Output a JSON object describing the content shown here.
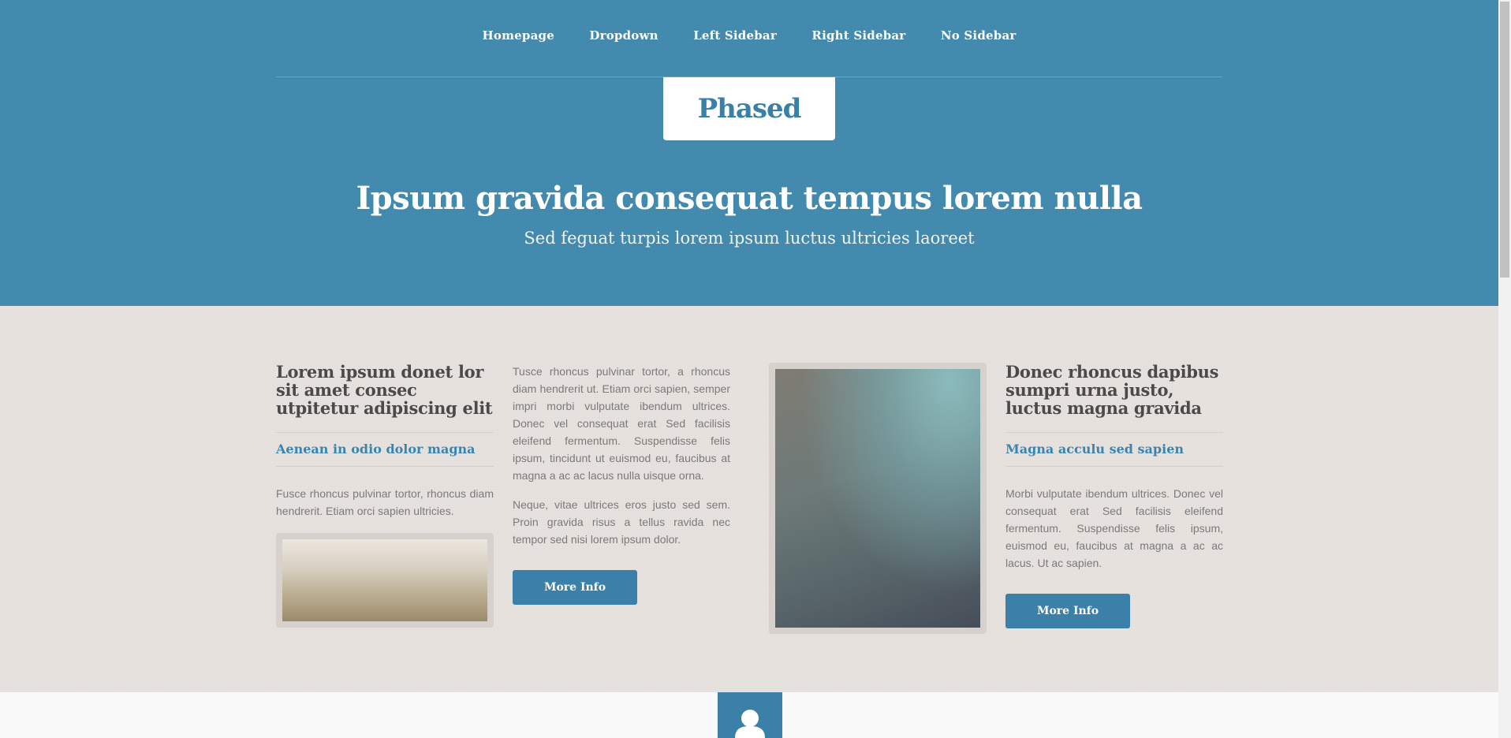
{
  "nav": {
    "items": [
      {
        "label": "Homepage"
      },
      {
        "label": "Dropdown"
      },
      {
        "label": "Left Sidebar"
      },
      {
        "label": "Right Sidebar"
      },
      {
        "label": "No Sidebar"
      }
    ]
  },
  "logo": {
    "text": "Phased"
  },
  "hero": {
    "title": "Ipsum gravida consequat tempus lorem nulla",
    "subtitle": "Sed feguat turpis lorem ipsum luctus ultricies laoreet"
  },
  "section_left": {
    "title": "Lorem ipsum donet lor sit amet consec utpitetur adipiscing elit",
    "subtitle": "Aenean in odio dolor magna",
    "text": "Fusce rhoncus pulvinar tortor, rhoncus diam hendrerit. Etiam orci sapien ultricies."
  },
  "section_middle": {
    "paragraph_1": "Tusce rhoncus pulvinar tortor, a rhoncus diam hendrerit ut. Etiam orci sapien, semper impri morbi vulputate ibendum ultrices. Donec vel consequat erat Sed facilisis eleifend fermentum. Suspendisse felis ipsum, tincidunt ut euismod eu, faucibus at magna a ac ac lacus nulla uisque orna.",
    "paragraph_2": "Neque, vitae ultrices eros justo sed sem. Proin gravida risus a tellus ravida nec tempor sed nisi lorem ipsum dolor.",
    "button_label": "More Info"
  },
  "section_right": {
    "title": "Donec rhoncus dapibus sumpri urna justo, luctus magna gravida",
    "subtitle": "Magna acculu sed sapien",
    "text": "Morbi vulputate ibendum ultrices. Donec vel consequat erat Sed facilisis eleifend fermentum. Suspendisse felis ipsum, euismod eu, faucibus at magna a ac ac lacus. Ut ac sapien.",
    "button_label": "More Info"
  },
  "colors": {
    "header_blue": "#4289ae",
    "accent_blue": "#3a80a9",
    "content_bg": "#e7e2df"
  },
  "icons": {
    "footer_icon": "user-icon"
  }
}
